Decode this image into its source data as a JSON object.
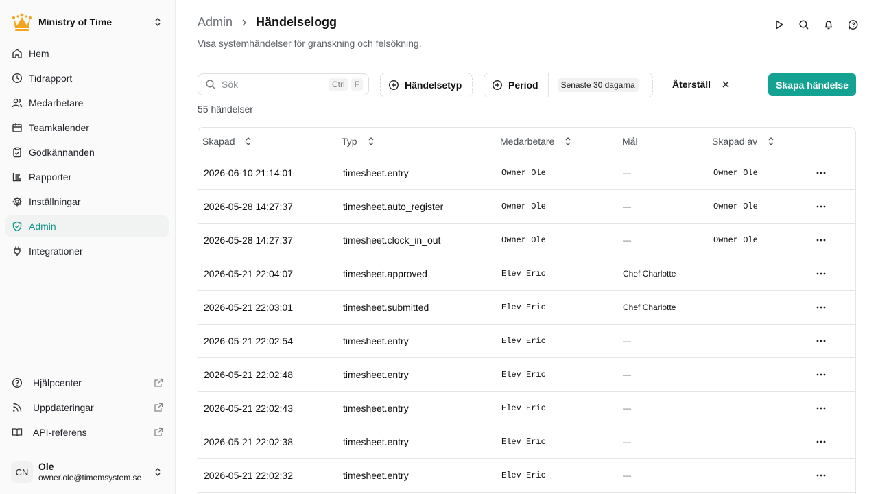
{
  "org": {
    "name": "Ministry of Time"
  },
  "nav": {
    "items": [
      {
        "label": "Hem",
        "icon": "home-icon"
      },
      {
        "label": "Tidrapport",
        "icon": "clock-icon"
      },
      {
        "label": "Medarbetare",
        "icon": "users-icon"
      },
      {
        "label": "Teamkalender",
        "icon": "calendar-icon"
      },
      {
        "label": "Godkännanden",
        "icon": "clipboard-check-icon"
      },
      {
        "label": "Rapporter",
        "icon": "report-icon"
      },
      {
        "label": "Inställningar",
        "icon": "gear-icon"
      },
      {
        "label": "Admin",
        "icon": "shield-icon",
        "active": true
      },
      {
        "label": "Integrationer",
        "icon": "plug-icon"
      }
    ],
    "footer": [
      {
        "label": "Hjälpcenter",
        "icon": "help-circle-icon"
      },
      {
        "label": "Uppdateringar",
        "icon": "rss-icon"
      },
      {
        "label": "API-referens",
        "icon": "book-icon"
      }
    ]
  },
  "user": {
    "initials": "CN",
    "name": "Ole",
    "email": "owner.ole@timemsystem.se"
  },
  "header": {
    "breadcrumb_parent": "Admin",
    "title": "Händelselogg",
    "subtitle": "Visa systemhändelser för granskning och felsökning."
  },
  "toolbar": {
    "search_placeholder": "Sök",
    "search_value": "",
    "kbd_ctrl": "Ctrl",
    "kbd_key": "F",
    "filter_type": "Händelsetyp",
    "filter_period": "Period",
    "period_value": "Senaste 30 dagarna",
    "reset": "Återställ",
    "create": "Skapa händelse"
  },
  "count_label": "55 händelser",
  "table": {
    "columns": [
      "Skapad",
      "Typ",
      "Medarbetare",
      "Mål",
      "Skapad av"
    ],
    "rows": [
      {
        "created": "2026-06-10 21:14:01",
        "type": "timesheet.entry",
        "employee": "Owner Ole",
        "target": "—",
        "created_by": "Owner Ole"
      },
      {
        "created": "2026-05-28 14:27:37",
        "type": "timesheet.auto_register",
        "employee": "Owner Ole",
        "target": "—",
        "created_by": "Owner Ole"
      },
      {
        "created": "2026-05-28 14:27:37",
        "type": "timesheet.clock_in_out",
        "employee": "Owner Ole",
        "target": "—",
        "created_by": "Owner Ole"
      },
      {
        "created": "2026-05-21 22:04:07",
        "type": "timesheet.approved",
        "employee": "Elev Eric",
        "target": "Chef Charlotte",
        "created_by": ""
      },
      {
        "created": "2026-05-21 22:03:01",
        "type": "timesheet.submitted",
        "employee": "Elev Eric",
        "target": "Chef Charlotte",
        "created_by": ""
      },
      {
        "created": "2026-05-21 22:02:54",
        "type": "timesheet.entry",
        "employee": "Elev Eric",
        "target": "—",
        "created_by": ""
      },
      {
        "created": "2026-05-21 22:02:48",
        "type": "timesheet.entry",
        "employee": "Elev Eric",
        "target": "—",
        "created_by": ""
      },
      {
        "created": "2026-05-21 22:02:43",
        "type": "timesheet.entry",
        "employee": "Elev Eric",
        "target": "—",
        "created_by": ""
      },
      {
        "created": "2026-05-21 22:02:38",
        "type": "timesheet.entry",
        "employee": "Elev Eric",
        "target": "—",
        "created_by": ""
      },
      {
        "created": "2026-05-21 22:02:32",
        "type": "timesheet.entry",
        "employee": "Elev Eric",
        "target": "—",
        "created_by": ""
      }
    ]
  },
  "colors": {
    "accent": "#14a392",
    "active_text": "#13998a"
  }
}
